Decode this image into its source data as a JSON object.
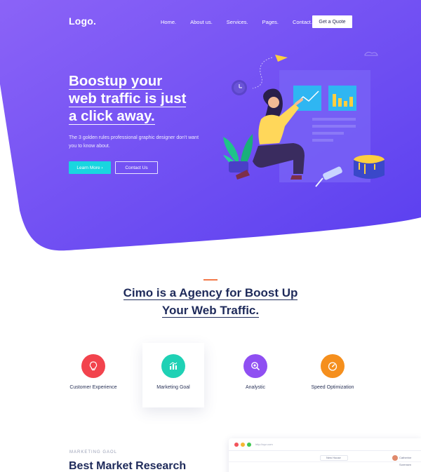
{
  "nav": {
    "logo": "Logo.",
    "links": [
      "Home.",
      "About us.",
      "Services.",
      "Pages.",
      "Contact."
    ],
    "cta": "Get a Quote"
  },
  "hero": {
    "title_lines": [
      "Boostup your",
      "web traffic is just",
      "a click away."
    ],
    "subtitle": "The 3 golden rules professional graphic designer don't want you to know about.",
    "primary_button": "Learn More ›",
    "secondary_button": "Contact Us"
  },
  "agency": {
    "title_lines": [
      "Cimo is a Agency for Boost Up",
      "Your Web Traffic."
    ]
  },
  "features": [
    {
      "label": "Customer Experience",
      "icon": "lightbulb-icon",
      "color": "#f2434d"
    },
    {
      "label": "Marketing Goal",
      "icon": "chart-icon",
      "color": "#1fd1b5"
    },
    {
      "label": "Analystic",
      "icon": "magnifier-icon",
      "color": "#8f4ff2"
    },
    {
      "label": "Speed Optimization",
      "icon": "speedometer-icon",
      "color": "#f58f1d"
    }
  ],
  "marketing": {
    "eyebrow": "MARKETING GAOL",
    "title": "Best Market Research"
  },
  "browser": {
    "url": "http://xyz.com",
    "tab_label": "New House",
    "user_name": "Catherine Sorensen"
  },
  "colors": {
    "hero_gradient_start": "#8a5cf6",
    "hero_gradient_end": "#5b3ff0",
    "accent_cyan": "#19d6df",
    "accent_orange": "#f3794a"
  }
}
